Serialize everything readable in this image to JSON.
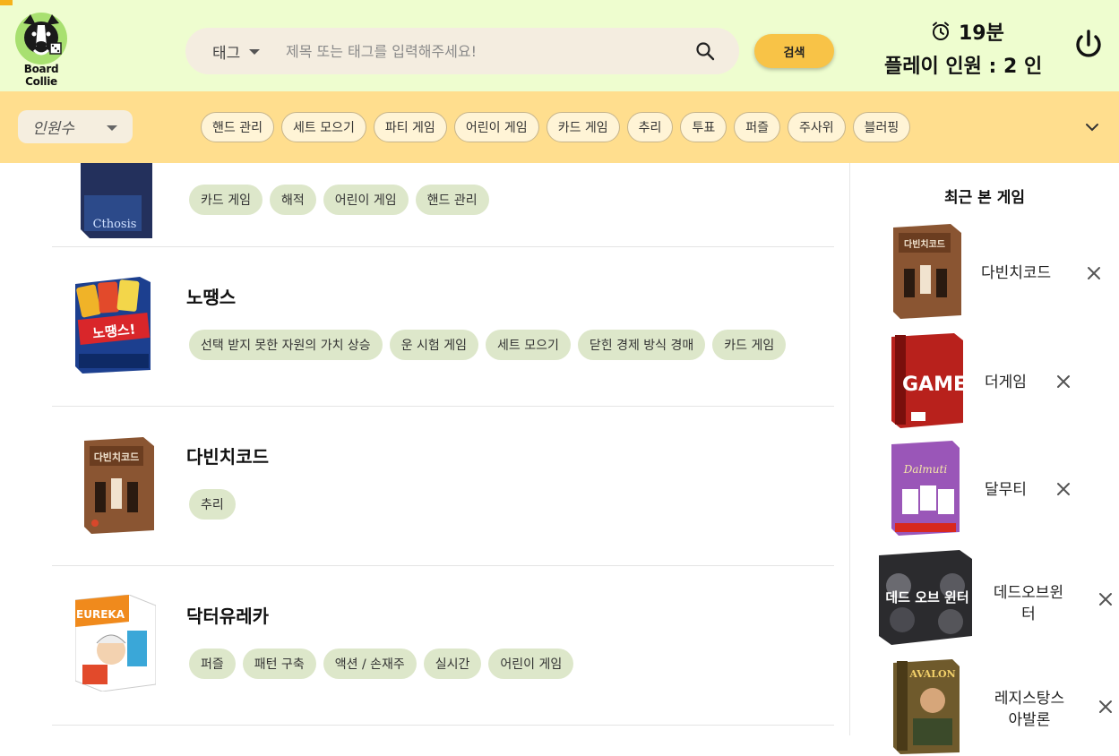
{
  "header": {
    "logo_text": "Board Collie",
    "search": {
      "tag_select_label": "태그",
      "placeholder": "제목 또는 태그를 입력해주세요!",
      "value": "",
      "button_label": "검색"
    },
    "timer_text": "19분",
    "players_text": "플레이 인원 : 2 인"
  },
  "filter_bar": {
    "people_select_label": "인원수",
    "tags": [
      "핸드 관리",
      "세트 모으기",
      "파티 게임",
      "어린이 게임",
      "카드 게임",
      "추리",
      "투표",
      "퍼즐",
      "주사위",
      "블러핑"
    ]
  },
  "games": [
    {
      "title": "",
      "tags": [
        "카드 게임",
        "해적",
        "어린이 게임",
        "핸드 관리"
      ],
      "cover_text": "Cthosis"
    },
    {
      "title": "노땡스",
      "tags": [
        "선택 받지 못한 자원의 가치 상승",
        "운 시험 게임",
        "세트 모으기",
        "닫힌 경제 방식 경매",
        "카드 게임"
      ],
      "cover_text": "노땡스!"
    },
    {
      "title": "다빈치코드",
      "tags": [
        "추리"
      ],
      "cover_text": "다빈치코드"
    },
    {
      "title": "닥터유레카",
      "tags": [
        "퍼즐",
        "패턴 구축",
        "액션 / 손재주",
        "실시간",
        "어린이 게임"
      ],
      "cover_text": "EUREKA"
    }
  ],
  "sidebar": {
    "title": "최근 본 게임",
    "recent": [
      {
        "name": "다빈치코드",
        "cover_text": "다빈치코드"
      },
      {
        "name": "더게임",
        "cover_text": "GAME"
      },
      {
        "name": "달무티",
        "cover_text": "Dalmuti"
      },
      {
        "name": "데드오브윈터",
        "cover_text": "데드 오브 윈터"
      },
      {
        "name": "레지스탕스 아발론",
        "cover_text": "AVALON"
      }
    ]
  },
  "colors": {
    "header_bg": "#eefdcf",
    "filter_bar_bg": "#ffde8e",
    "search_button": "#f8c347",
    "tag_chip": "#dde7ca"
  },
  "icons": [
    "search-icon",
    "alarm-clock-icon",
    "power-icon",
    "chevron-down-icon",
    "close-icon"
  ]
}
